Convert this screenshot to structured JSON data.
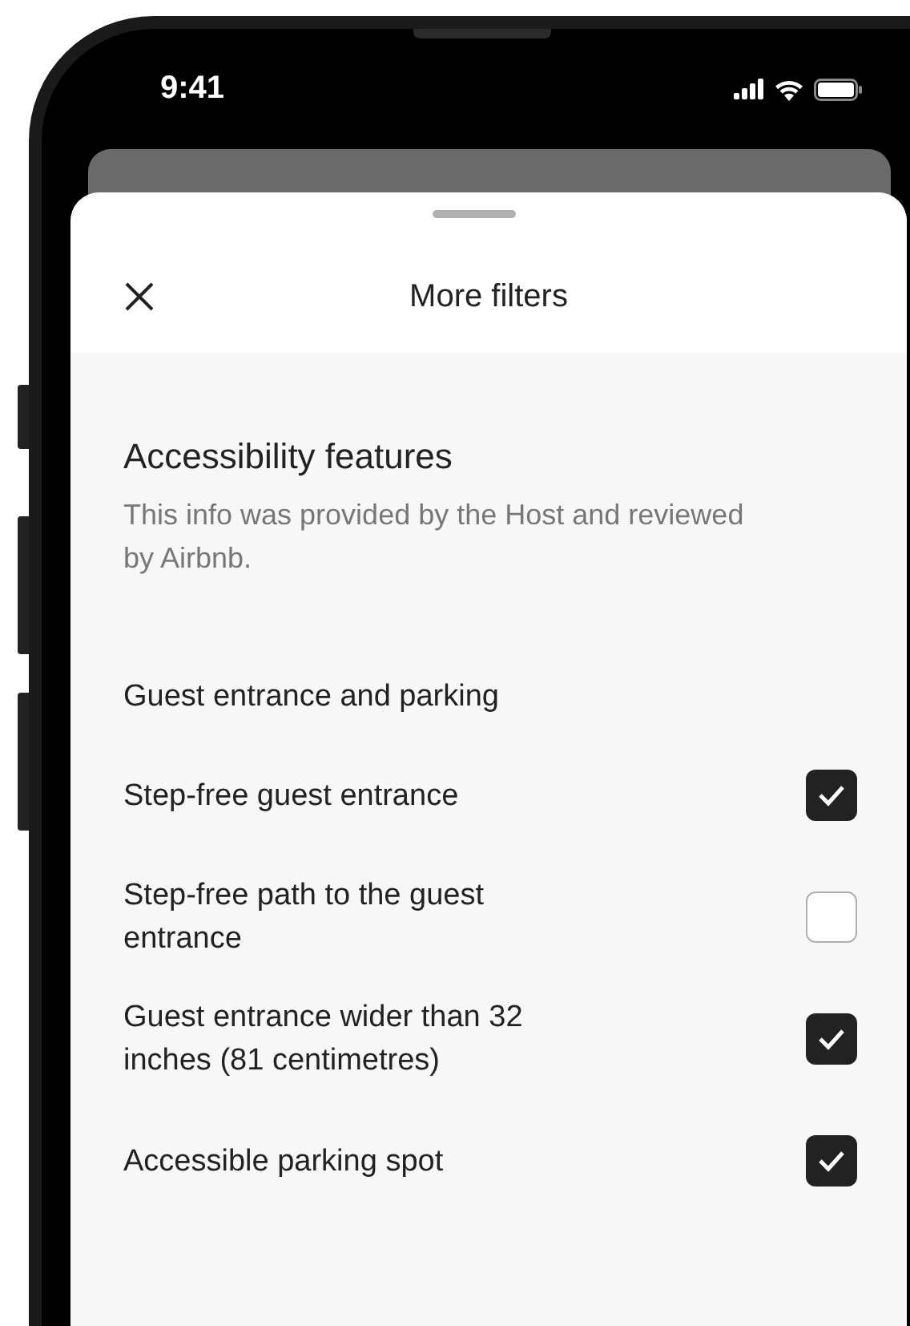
{
  "status_bar": {
    "time": "9:41"
  },
  "sheet": {
    "title": "More filters"
  },
  "section": {
    "title": "Accessibility features",
    "description": "This info was provided by the Host and reviewed by Airbnb."
  },
  "group": {
    "title": "Guest entrance and parking",
    "options": [
      {
        "label": "Step-free guest entrance",
        "checked": true
      },
      {
        "label": "Step-free path to the guest entrance",
        "checked": false
      },
      {
        "label": "Guest entrance wider than 32 inches (81 centimetres)",
        "checked": true
      },
      {
        "label": "Accessible parking spot",
        "checked": true
      }
    ]
  }
}
